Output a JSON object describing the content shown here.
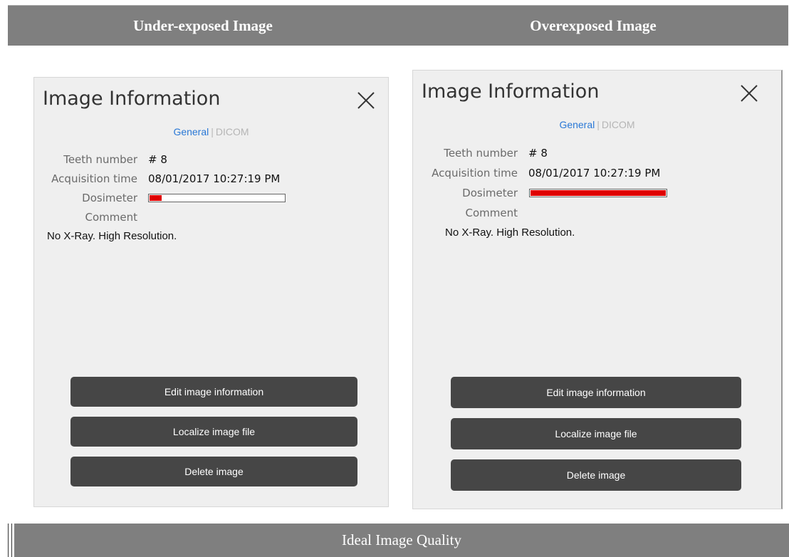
{
  "header": {
    "left_title": "Under-exposed Image",
    "right_title": "Overexposed Image"
  },
  "panels": [
    {
      "title": "Image Information",
      "tabs": {
        "general": "General",
        "separator": "|",
        "dicom": "DICOM"
      },
      "fields": {
        "teeth_label": "Teeth number",
        "teeth_value": "# 8",
        "acq_label": "Acquisition time",
        "acq_value": "08/01/2017 10:27:19 PM",
        "dosimeter_label": "Dosimeter",
        "dosimeter_level": 0.09,
        "comment_label": "Comment",
        "comment_value": "No X-Ray. High Resolution."
      },
      "buttons": {
        "edit": "Edit image information",
        "localize": "Localize image file",
        "delete": "Delete image"
      }
    },
    {
      "title": "Image Information",
      "tabs": {
        "general": "General",
        "separator": "|",
        "dicom": "DICOM"
      },
      "fields": {
        "teeth_label": "Teeth number",
        "teeth_value": "# 8",
        "acq_label": "Acquisition time",
        "acq_value": "08/01/2017 10:27:19 PM",
        "dosimeter_label": "Dosimeter",
        "dosimeter_level": 1.0,
        "comment_label": "Comment",
        "comment_value": "No X-Ray. High Resolution."
      },
      "buttons": {
        "edit": "Edit image information",
        "localize": "Localize image file",
        "delete": "Delete image"
      }
    }
  ],
  "footer": {
    "title": "Ideal Image Quality"
  },
  "colors": {
    "dosimeter_fill": "#e00000",
    "tab_active": "#2a78d6",
    "button_bg": "#464646",
    "header_bg": "#7f7f7f"
  }
}
